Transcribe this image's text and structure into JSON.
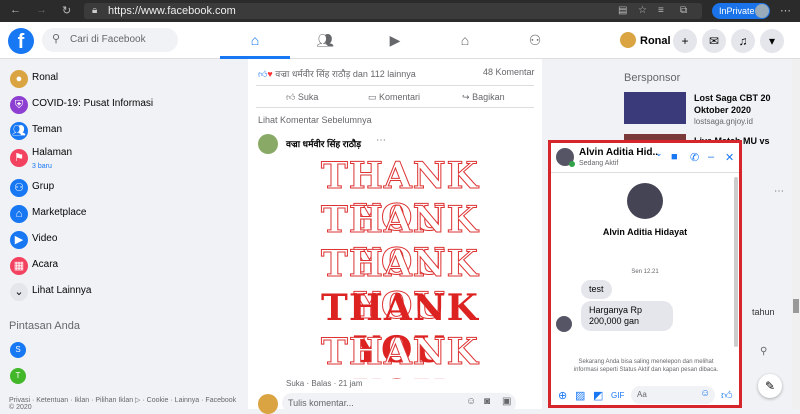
{
  "browser": {
    "url": "https://www.facebook.com",
    "inprivate_label": "InPrivate"
  },
  "header": {
    "logo": "f",
    "search_placeholder": "Cari di Facebook",
    "profile_name": "Ronal",
    "nav_tabs": [
      "home-icon",
      "friends-icon",
      "watch-icon",
      "marketplace-icon",
      "groups-icon"
    ]
  },
  "sidebar": {
    "items": [
      {
        "label": "Ronal",
        "icon": "avatar",
        "color": "#d9a441"
      },
      {
        "label": "COVID-19: Pusat Informasi",
        "icon": "shield-icon",
        "color": "#8c3fd1"
      },
      {
        "label": "Teman",
        "icon": "friends-icon",
        "color": "#1877f2"
      },
      {
        "label": "Halaman",
        "icon": "flag-icon",
        "color": "#f3425f",
        "sub": "3 baru"
      },
      {
        "label": "Grup",
        "icon": "groups-icon",
        "color": "#1877f2"
      },
      {
        "label": "Marketplace",
        "icon": "shop-icon",
        "color": "#1877f2"
      },
      {
        "label": "Video",
        "icon": "video-icon",
        "color": "#1877f2"
      },
      {
        "label": "Acara",
        "icon": "calendar-icon",
        "color": "#f3425f"
      },
      {
        "label": "Lihat Lainnya",
        "icon": "chevron-down-icon",
        "color": "#e4e6eb"
      }
    ],
    "shortcuts_title": "Pintasan Anda",
    "shortcuts": [
      {
        "letter": "S",
        "color": "#1877f2"
      },
      {
        "letter": "T",
        "color": "#42b72a"
      }
    ],
    "footer": "Privasi · Ketentuan · Iklan · Pilihan Iklan ▷ · Cookie · Lainnya · Facebook © 2020"
  },
  "feed": {
    "reactions_text": "वज्रा धर्मवीर सिंह राठौड़ dan 112 lainnya",
    "comment_count": "48 Komentar",
    "actions": {
      "like": "Suka",
      "comment": "Komentari",
      "share": "Bagikan"
    },
    "prev_comments": "Lihat Komentar Sebelumnya",
    "comment_author": "वज्रा धर्मवीर सिंह राठौड़",
    "comment_image_lines": [
      "THANK YOU",
      "THANK YOU",
      "THANK YOU",
      "THANK YOU",
      "THANK YOU"
    ],
    "comment_actions": "Suka · Balas · 21 jam",
    "write_placeholder": "Tulis komentar..."
  },
  "right": {
    "sponsored_title": "Bersponsor",
    "ad1_title": "Lost Saga CBT 20 Oktober 2020",
    "ad1_url": "lostsaga.gnjoy.id",
    "ad2_title": "Live Match MU vs",
    "partial_text": "tahun"
  },
  "chat": {
    "name": "Alvin Aditia Hid...",
    "status": "Sedang Aktif",
    "full_name": "Alvin Aditia Hidayat",
    "time": "Sen 12.21",
    "messages": [
      {
        "text": "test"
      },
      {
        "text": "Harganya Rp 200,000 gan"
      }
    ],
    "info": "Sekarang Anda bisa saling menelepon dan melihat informasi seperti Status Aktif dan kapan pesan dibaca.",
    "input_placeholder": "Aa",
    "accent": "#1877f2"
  }
}
